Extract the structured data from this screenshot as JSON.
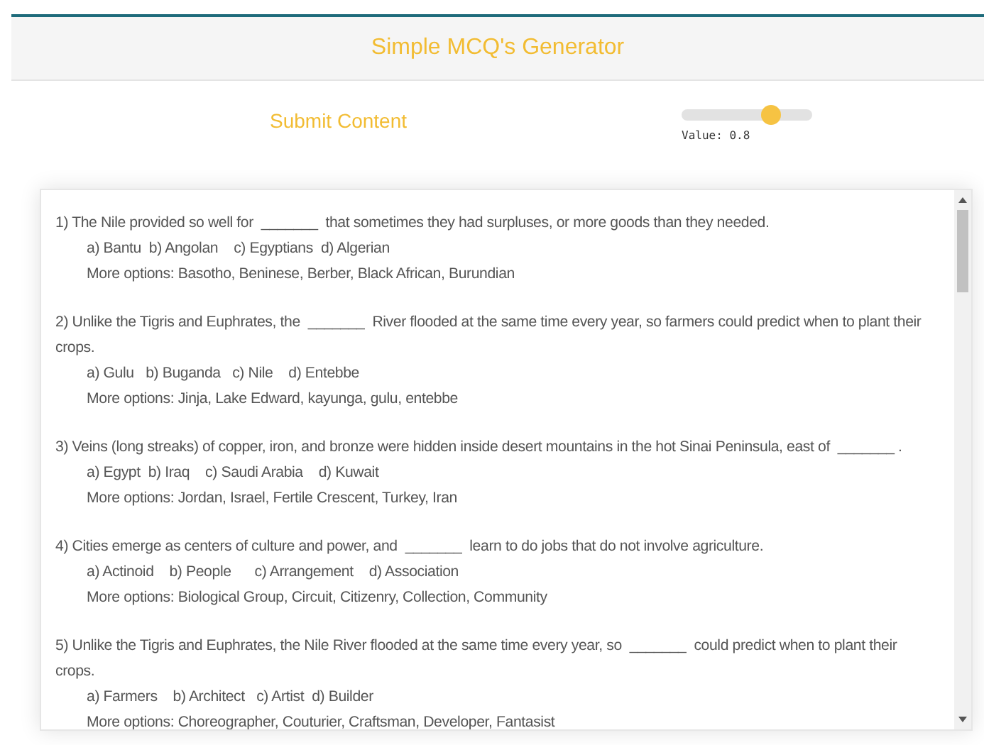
{
  "header": {
    "title": "Simple MCQ's Generator"
  },
  "controls": {
    "submit_label": "Submit Content",
    "slider": {
      "level": 0.68,
      "reading": "Value: 0.8"
    }
  },
  "questions": [
    {
      "text": "1) The Nile provided so well for  _______  that sometimes they had surpluses, or more goods than they needed.",
      "options": "a) Bantu  b) Angolan    c) Egyptians  d) Algerian",
      "more": "More options: Basotho, Beninese, Berber, Black African, Burundian"
    },
    {
      "text": "2) Unlike the Tigris and Euphrates, the  _______  River flooded at the same time every year, so farmers could predict when to plant their crops.",
      "options": "a) Gulu   b) Buganda   c) Nile    d) Entebbe",
      "more": "More options: Jinja, Lake Edward, kayunga, gulu, entebbe"
    },
    {
      "text": "3) Veins (long streaks) of copper, iron, and bronze were hidden inside desert mountains in the hot Sinai Peninsula, east of  _______ .",
      "options": "a) Egypt  b) Iraq    c) Saudi Arabia    d) Kuwait",
      "more": "More options: Jordan, Israel, Fertile Crescent, Turkey, Iran"
    },
    {
      "text": "4) Cities emerge as centers of culture and power, and  _______  learn to do jobs that do not involve agriculture.",
      "options": "a) Actinoid    b) People      c) Arrangement    d) Association",
      "more": "More options: Biological Group, Circuit, Citizenry, Collection, Community"
    },
    {
      "text": "5) Unlike the Tigris and Euphrates, the Nile River flooded at the same time every year, so  _______  could predict when to plant their crops.",
      "options": "a) Farmers    b) Architect   c) Artist  d) Builder",
      "more": "More options: Choreographer, Couturier, Craftsman, Developer, Fantasist"
    }
  ]
}
